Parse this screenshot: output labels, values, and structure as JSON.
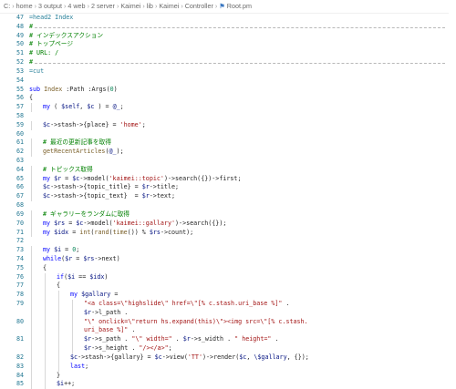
{
  "breadcrumb": {
    "items": [
      "C:",
      "home",
      "3 output",
      "4 web",
      "2 server",
      "Kaimei",
      "lib",
      "Kaimei",
      "Controller"
    ],
    "file_icon": "perl-module-icon",
    "file_name": "Root.pm"
  },
  "lines": [
    {
      "n": "47",
      "tokens": [
        {
          "t": "=head2 Index",
          "c": "t-pod"
        }
      ]
    },
    {
      "n": "48",
      "tokens": [
        {
          "t": "#",
          "c": "t-cmt"
        }
      ],
      "dashed": true
    },
    {
      "n": "49",
      "tokens": [
        {
          "t": "# インデックスアクション",
          "c": "t-cmt"
        }
      ]
    },
    {
      "n": "50",
      "tokens": [
        {
          "t": "# トップページ",
          "c": "t-cmt"
        }
      ]
    },
    {
      "n": "51",
      "tokens": [
        {
          "t": "# URL: /",
          "c": "t-cmt"
        }
      ]
    },
    {
      "n": "52",
      "tokens": [
        {
          "t": "#",
          "c": "t-cmt"
        }
      ],
      "dashed": true
    },
    {
      "n": "53",
      "tokens": [
        {
          "t": "=cut",
          "c": "t-pod"
        }
      ]
    },
    {
      "n": "54",
      "tokens": []
    },
    {
      "n": "55",
      "tokens": [
        {
          "t": "sub ",
          "c": "t-kw"
        },
        {
          "t": "Index",
          "c": "t-fn"
        },
        {
          "t": " :Path :Args(",
          "c": "t-plain"
        },
        {
          "t": "0",
          "c": "t-num"
        },
        {
          "t": ")",
          "c": "t-plain"
        }
      ]
    },
    {
      "n": "56",
      "tokens": [
        {
          "t": "{",
          "c": "t-plain"
        }
      ]
    },
    {
      "n": "57",
      "indent": 1,
      "tokens": [
        {
          "t": "my",
          "c": "t-kw"
        },
        {
          "t": " ( ",
          "c": "t-plain"
        },
        {
          "t": "$self",
          "c": "t-var"
        },
        {
          "t": ", ",
          "c": "t-plain"
        },
        {
          "t": "$c",
          "c": "t-var"
        },
        {
          "t": " ) = ",
          "c": "t-plain"
        },
        {
          "t": "@_",
          "c": "t-var"
        },
        {
          "t": ";",
          "c": "t-plain"
        }
      ]
    },
    {
      "n": "58",
      "tokens": []
    },
    {
      "n": "59",
      "indent": 1,
      "tokens": [
        {
          "t": "$c",
          "c": "t-var"
        },
        {
          "t": "->stash->{place} = ",
          "c": "t-plain"
        },
        {
          "t": "'home'",
          "c": "t-str"
        },
        {
          "t": ";",
          "c": "t-plain"
        }
      ]
    },
    {
      "n": "60",
      "tokens": []
    },
    {
      "n": "61",
      "indent": 1,
      "tokens": [
        {
          "t": "# 最近の更新記事を取得",
          "c": "t-cmt"
        }
      ]
    },
    {
      "n": "62",
      "indent": 1,
      "tokens": [
        {
          "t": "getRecentArticles",
          "c": "t-fn"
        },
        {
          "t": "(",
          "c": "t-plain"
        },
        {
          "t": "@_",
          "c": "t-var"
        },
        {
          "t": ");",
          "c": "t-plain"
        }
      ]
    },
    {
      "n": "63",
      "tokens": []
    },
    {
      "n": "64",
      "indent": 1,
      "tokens": [
        {
          "t": "# トピックス取得",
          "c": "t-cmt"
        }
      ]
    },
    {
      "n": "65",
      "indent": 1,
      "tokens": [
        {
          "t": "my",
          "c": "t-kw"
        },
        {
          "t": " ",
          "c": "t-plain"
        },
        {
          "t": "$r",
          "c": "t-var"
        },
        {
          "t": " = ",
          "c": "t-plain"
        },
        {
          "t": "$c",
          "c": "t-var"
        },
        {
          "t": "->model(",
          "c": "t-plain"
        },
        {
          "t": "'kaimei::topic'",
          "c": "t-str"
        },
        {
          "t": ")->search({})->first;",
          "c": "t-plain"
        }
      ]
    },
    {
      "n": "66",
      "indent": 1,
      "tokens": [
        {
          "t": "$c",
          "c": "t-var"
        },
        {
          "t": "->stash->{topic_title} = ",
          "c": "t-plain"
        },
        {
          "t": "$r",
          "c": "t-var"
        },
        {
          "t": "->title;",
          "c": "t-plain"
        }
      ]
    },
    {
      "n": "67",
      "indent": 1,
      "tokens": [
        {
          "t": "$c",
          "c": "t-var"
        },
        {
          "t": "->stash->{topic_text}  = ",
          "c": "t-plain"
        },
        {
          "t": "$r",
          "c": "t-var"
        },
        {
          "t": "->text;",
          "c": "t-plain"
        }
      ]
    },
    {
      "n": "68",
      "tokens": []
    },
    {
      "n": "69",
      "indent": 1,
      "tokens": [
        {
          "t": "# ギャラリーをランダムに取得",
          "c": "t-cmt"
        }
      ]
    },
    {
      "n": "70",
      "indent": 1,
      "tokens": [
        {
          "t": "my",
          "c": "t-kw"
        },
        {
          "t": " ",
          "c": "t-plain"
        },
        {
          "t": "$rs",
          "c": "t-var"
        },
        {
          "t": " = ",
          "c": "t-plain"
        },
        {
          "t": "$c",
          "c": "t-var"
        },
        {
          "t": "->model(",
          "c": "t-plain"
        },
        {
          "t": "'kaimei::gallary'",
          "c": "t-str"
        },
        {
          "t": ")->search({});",
          "c": "t-plain"
        }
      ]
    },
    {
      "n": "71",
      "indent": 1,
      "tokens": [
        {
          "t": "my",
          "c": "t-kw"
        },
        {
          "t": " ",
          "c": "t-plain"
        },
        {
          "t": "$idx",
          "c": "t-var"
        },
        {
          "t": " = ",
          "c": "t-plain"
        },
        {
          "t": "int",
          "c": "t-fn"
        },
        {
          "t": "(",
          "c": "t-plain"
        },
        {
          "t": "rand",
          "c": "t-fn"
        },
        {
          "t": "(",
          "c": "t-plain"
        },
        {
          "t": "time",
          "c": "t-fn"
        },
        {
          "t": "()) % ",
          "c": "t-plain"
        },
        {
          "t": "$rs",
          "c": "t-var"
        },
        {
          "t": "->count);",
          "c": "t-plain"
        }
      ]
    },
    {
      "n": "72",
      "tokens": []
    },
    {
      "n": "73",
      "indent": 1,
      "tokens": [
        {
          "t": "my",
          "c": "t-kw"
        },
        {
          "t": " ",
          "c": "t-plain"
        },
        {
          "t": "$i",
          "c": "t-var"
        },
        {
          "t": " = ",
          "c": "t-plain"
        },
        {
          "t": "0",
          "c": "t-num"
        },
        {
          "t": ";",
          "c": "t-plain"
        }
      ]
    },
    {
      "n": "74",
      "indent": 1,
      "tokens": [
        {
          "t": "while",
          "c": "t-kw"
        },
        {
          "t": "(",
          "c": "t-plain"
        },
        {
          "t": "$r",
          "c": "t-var"
        },
        {
          "t": " = ",
          "c": "t-plain"
        },
        {
          "t": "$rs",
          "c": "t-var"
        },
        {
          "t": "->next)",
          "c": "t-plain"
        }
      ]
    },
    {
      "n": "75",
      "indent": 1,
      "tokens": [
        {
          "t": "{",
          "c": "t-plain"
        }
      ]
    },
    {
      "n": "76",
      "indent": 2,
      "tokens": [
        {
          "t": "if",
          "c": "t-kw"
        },
        {
          "t": "(",
          "c": "t-plain"
        },
        {
          "t": "$i",
          "c": "t-var"
        },
        {
          "t": " == ",
          "c": "t-plain"
        },
        {
          "t": "$idx",
          "c": "t-var"
        },
        {
          "t": ")",
          "c": "t-plain"
        }
      ]
    },
    {
      "n": "77",
      "indent": 2,
      "tokens": [
        {
          "t": "{",
          "c": "t-plain"
        }
      ]
    },
    {
      "n": "78",
      "indent": 3,
      "tokens": [
        {
          "t": "my",
          "c": "t-kw"
        },
        {
          "t": " ",
          "c": "t-plain"
        },
        {
          "t": "$gallary",
          "c": "t-var"
        },
        {
          "t": " =",
          "c": "t-plain"
        }
      ]
    },
    {
      "n": "79",
      "indent": 4,
      "tokens": [
        {
          "t": "\"<a class=\\\"highslide\\\" href=\\\"[% c.stash.uri_base %]\"",
          "c": "t-str"
        },
        {
          "t": " .",
          "c": "t-plain"
        }
      ]
    },
    {
      "n": "",
      "indent": 4,
      "tokens": [
        {
          "t": "$r",
          "c": "t-var"
        },
        {
          "t": "->l_path .",
          "c": "t-plain"
        }
      ]
    },
    {
      "n": "80",
      "indent": 4,
      "tokens": [
        {
          "t": "\"\\\" onclick=\\\"return hs.expand(this)\\\"><img src=\\\"[% c.stash.",
          "c": "t-str"
        }
      ]
    },
    {
      "n": "",
      "indent": 4,
      "tokens": [
        {
          "t": "uri_base %]\"",
          "c": "t-str"
        },
        {
          "t": " .",
          "c": "t-plain"
        }
      ]
    },
    {
      "n": "81",
      "indent": 4,
      "tokens": [
        {
          "t": "$r",
          "c": "t-var"
        },
        {
          "t": "->s_path . ",
          "c": "t-plain"
        },
        {
          "t": "\"\\\" width=\"",
          "c": "t-str"
        },
        {
          "t": " . ",
          "c": "t-plain"
        },
        {
          "t": "$r",
          "c": "t-var"
        },
        {
          "t": "->s_width . ",
          "c": "t-plain"
        },
        {
          "t": "\" height=\"",
          "c": "t-str"
        },
        {
          "t": " .",
          "c": "t-plain"
        }
      ]
    },
    {
      "n": "",
      "indent": 4,
      "tokens": [
        {
          "t": "$r",
          "c": "t-var"
        },
        {
          "t": "->s_height . ",
          "c": "t-plain"
        },
        {
          "t": "\"/></a>\"",
          "c": "t-str"
        },
        {
          "t": ";",
          "c": "t-plain"
        }
      ]
    },
    {
      "n": "82",
      "indent": 3,
      "tokens": [
        {
          "t": "$c",
          "c": "t-var"
        },
        {
          "t": "->stash->{gallary} = ",
          "c": "t-plain"
        },
        {
          "t": "$c",
          "c": "t-var"
        },
        {
          "t": "->view(",
          "c": "t-plain"
        },
        {
          "t": "'TT'",
          "c": "t-str"
        },
        {
          "t": ")->render(",
          "c": "t-plain"
        },
        {
          "t": "$c",
          "c": "t-var"
        },
        {
          "t": ", ",
          "c": "t-plain"
        },
        {
          "t": "\\$gallary",
          "c": "t-var"
        },
        {
          "t": ", {});",
          "c": "t-plain"
        }
      ]
    },
    {
      "n": "83",
      "indent": 3,
      "tokens": [
        {
          "t": "last",
          "c": "t-kw"
        },
        {
          "t": ";",
          "c": "t-plain"
        }
      ]
    },
    {
      "n": "84",
      "indent": 2,
      "tokens": [
        {
          "t": "}",
          "c": "t-plain"
        }
      ]
    },
    {
      "n": "85",
      "indent": 2,
      "tokens": [
        {
          "t": "$i",
          "c": "t-var"
        },
        {
          "t": "++;",
          "c": "t-plain"
        }
      ]
    }
  ]
}
